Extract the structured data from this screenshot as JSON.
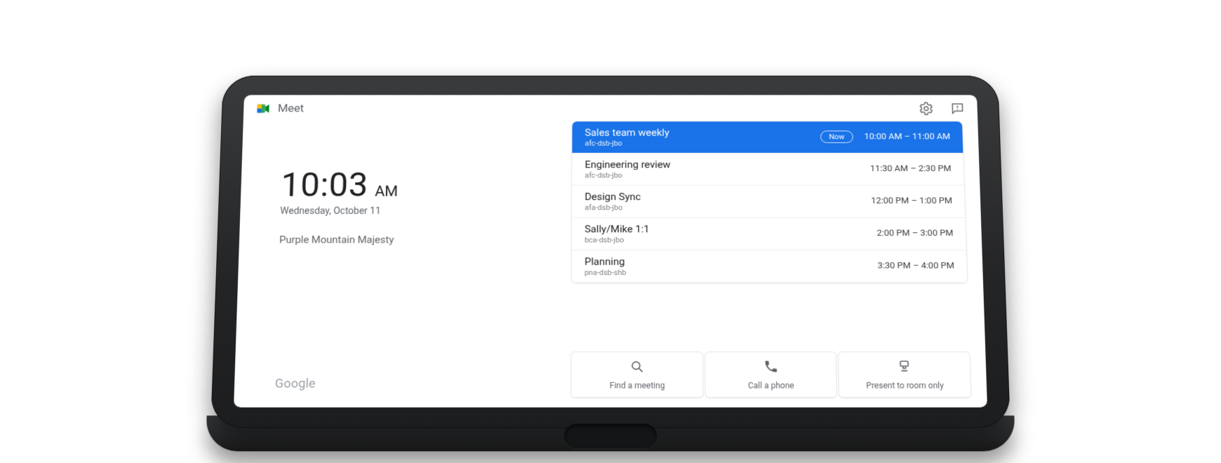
{
  "header": {
    "app_title": "Meet"
  },
  "clock": {
    "time": "10:03",
    "ampm": "AM",
    "date": "Wednesday, October 11",
    "room_name": "Purple Mountain Majesty"
  },
  "footer": {
    "brand": "Google"
  },
  "events": [
    {
      "title": "Sales team weekly",
      "code": "afc-dsb-jbo",
      "time": "10:00 AM – 11:00 AM",
      "now_label": "Now",
      "active": true
    },
    {
      "title": "Engineering review",
      "code": "afc-dsb-jbo",
      "time": "11:30 AM – 2:30 PM",
      "now_label": "",
      "active": false
    },
    {
      "title": "Design Sync",
      "code": "afa-dsb-jbo",
      "time": "12:00 PM – 1:00 PM",
      "now_label": "",
      "active": false
    },
    {
      "title": "Sally/Mike 1:1",
      "code": "bca-dsb-jbo",
      "time": "2:00 PM – 3:00 PM",
      "now_label": "",
      "active": false
    },
    {
      "title": "Planning",
      "code": "pna-dsb-shb",
      "time": "3:30 PM – 4:00 PM",
      "now_label": "",
      "active": false
    }
  ],
  "actions": {
    "find": {
      "label": "Find a meeting"
    },
    "call": {
      "label": "Call a phone"
    },
    "present": {
      "label": "Present to room only"
    }
  }
}
